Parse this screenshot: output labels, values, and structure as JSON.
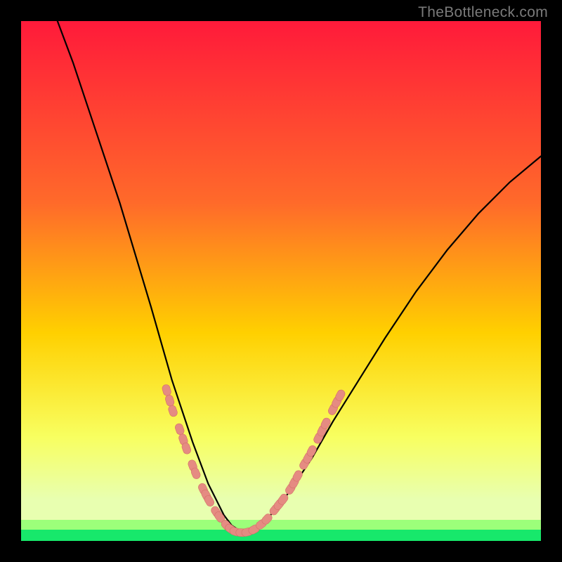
{
  "watermark": "TheBottleneck.com",
  "colors": {
    "black": "#000000",
    "gradient_top": "#ff1a3a",
    "gradient_mid1": "#ff6a2a",
    "gradient_mid2": "#ffd000",
    "gradient_mid3": "#f8ff60",
    "gradient_bottom_glow": "#e8ffb0",
    "green_band_light": "#9cff7a",
    "green_band": "#17e86b",
    "curve": "#000000",
    "marker_fill": "#e58b82",
    "marker_stroke": "#d47068"
  },
  "chart_data": {
    "type": "line",
    "title": "",
    "xlabel": "",
    "ylabel": "",
    "xlim": [
      0,
      100
    ],
    "ylim": [
      0,
      100
    ],
    "curve": {
      "x": [
        7,
        10,
        13,
        16,
        19,
        22,
        25,
        27,
        29,
        31,
        33,
        34.5,
        36,
        37.5,
        39,
        40.5,
        42,
        44,
        46,
        49,
        52,
        56,
        60,
        65,
        70,
        76,
        82,
        88,
        94,
        100
      ],
      "y": [
        100,
        92,
        83,
        74,
        65,
        55,
        45,
        38,
        31,
        25,
        19,
        15,
        11,
        8,
        5,
        3,
        2,
        2,
        3,
        6,
        10,
        16,
        23,
        31,
        39,
        48,
        56,
        63,
        69,
        74
      ]
    },
    "markers": [
      {
        "x": 28.0,
        "y": 29.0
      },
      {
        "x": 28.6,
        "y": 27.0
      },
      {
        "x": 29.2,
        "y": 25.0
      },
      {
        "x": 30.5,
        "y": 21.5
      },
      {
        "x": 31.2,
        "y": 19.5
      },
      {
        "x": 31.8,
        "y": 17.8
      },
      {
        "x": 33.0,
        "y": 14.5
      },
      {
        "x": 33.6,
        "y": 13.0
      },
      {
        "x": 35.0,
        "y": 10.0
      },
      {
        "x": 35.6,
        "y": 8.8
      },
      {
        "x": 36.2,
        "y": 7.7
      },
      {
        "x": 37.5,
        "y": 5.6
      },
      {
        "x": 38.2,
        "y": 4.6
      },
      {
        "x": 39.5,
        "y": 3.0
      },
      {
        "x": 40.3,
        "y": 2.3
      },
      {
        "x": 41.2,
        "y": 1.8
      },
      {
        "x": 42.4,
        "y": 1.6
      },
      {
        "x": 43.5,
        "y": 1.7
      },
      {
        "x": 44.8,
        "y": 2.2
      },
      {
        "x": 46.2,
        "y": 3.2
      },
      {
        "x": 47.3,
        "y": 4.2
      },
      {
        "x": 48.8,
        "y": 6.0
      },
      {
        "x": 49.6,
        "y": 7.0
      },
      {
        "x": 50.4,
        "y": 8.0
      },
      {
        "x": 51.8,
        "y": 10.0
      },
      {
        "x": 52.5,
        "y": 11.2
      },
      {
        "x": 53.2,
        "y": 12.5
      },
      {
        "x": 54.5,
        "y": 14.8
      },
      {
        "x": 55.2,
        "y": 16.0
      },
      {
        "x": 55.9,
        "y": 17.3
      },
      {
        "x": 57.2,
        "y": 19.8
      },
      {
        "x": 57.9,
        "y": 21.2
      },
      {
        "x": 58.6,
        "y": 22.6
      },
      {
        "x": 60.0,
        "y": 25.3
      },
      {
        "x": 60.7,
        "y": 26.7
      },
      {
        "x": 61.4,
        "y": 28.0
      }
    ]
  }
}
